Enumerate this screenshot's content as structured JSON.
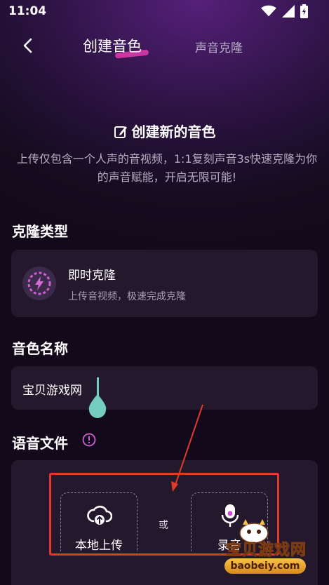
{
  "status_bar": {
    "time": "11:04"
  },
  "nav": {
    "active_tab": "创建音色",
    "other_tab": "声音克隆"
  },
  "headline": {
    "title": "创建新的音色",
    "description": "上传仅包含一个人声的音视频，1:1复刻声音3s快速克隆为你的声音赋能，开启无限可能!"
  },
  "clone_type": {
    "section_title": "克隆类型",
    "option_name": "即时克隆",
    "option_desc": "上传音视频，极速完成克隆"
  },
  "voice_name": {
    "section_title": "音色名称",
    "value": "宝贝游戏网"
  },
  "voice_file": {
    "section_title": "语音文件",
    "upload_label": "本地上传",
    "or_label": "或",
    "record_label": "录音"
  },
  "watermark": {
    "title": "宝贝游戏网",
    "url": "baobeiy.com"
  },
  "colors": {
    "accent": "#d93aa8",
    "annotation": "#e03a2a",
    "caret": "#74cdbf"
  },
  "icons": [
    "wifi-icon",
    "signal-icon",
    "battery-icon",
    "back-icon",
    "edit-icon",
    "lightning-icon",
    "info-icon",
    "cloud-upload-icon",
    "microphone-icon"
  ]
}
